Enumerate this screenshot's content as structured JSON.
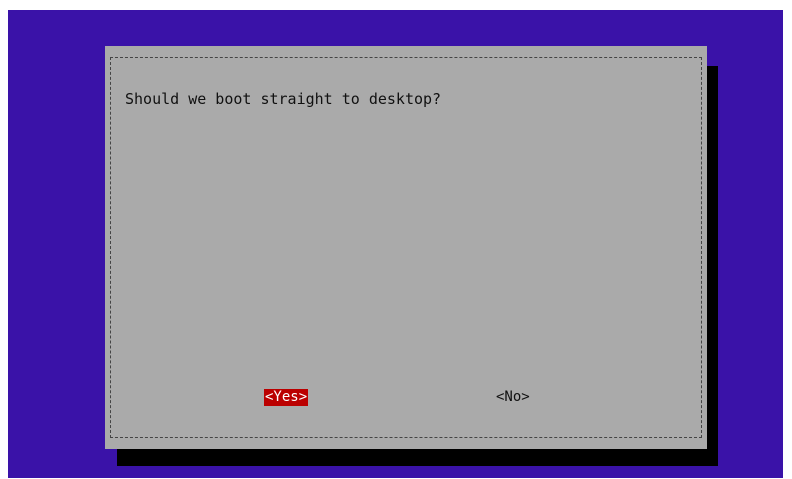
{
  "dialog": {
    "prompt": "Should we boot straight to desktop?",
    "buttons": [
      {
        "label": "<Yes>",
        "selected": true
      },
      {
        "label": "<No>",
        "selected": false
      }
    ]
  },
  "colors": {
    "background": "#3a12a8",
    "dialog": "#aaaaaa",
    "shadow": "#000000",
    "selected_button": "#bb0000"
  }
}
